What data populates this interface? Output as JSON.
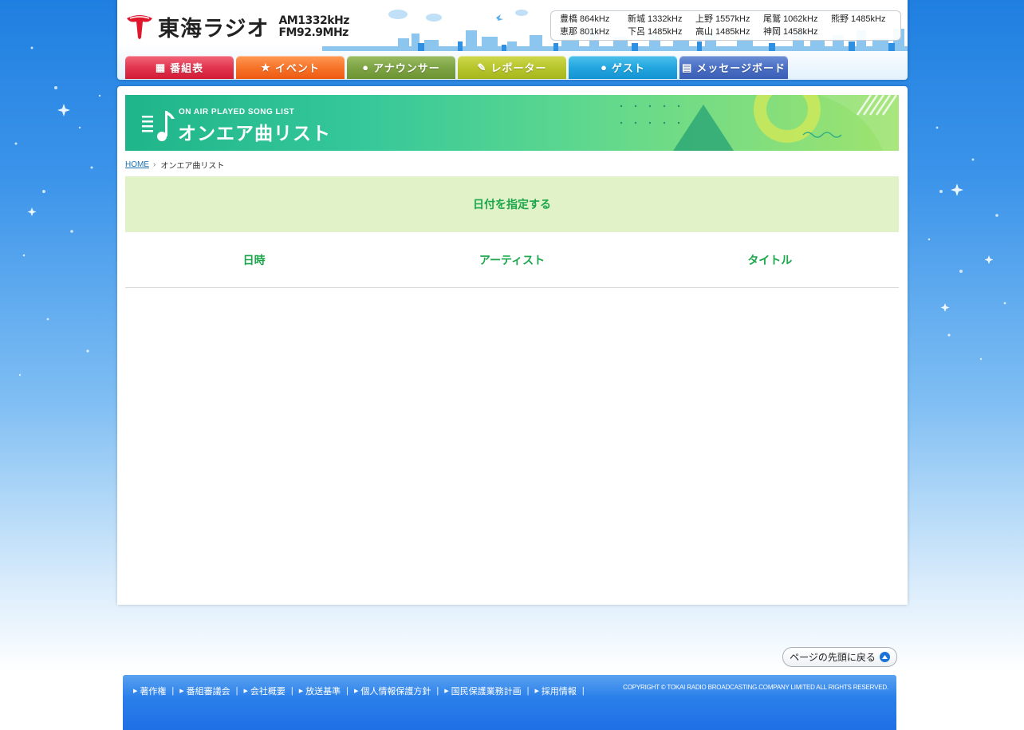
{
  "header": {
    "logo_text": "東海ラジオ",
    "logo_am": "AM1332kHz",
    "logo_fm": "FM92.9MHz",
    "frequencies": [
      "豊橋 864kHz",
      "新城 1332kHz",
      "上野 1557kHz",
      "尾鷲 1062kHz",
      "熊野 1485kHz",
      "恵那 801kHz",
      "下呂 1485kHz",
      "高山 1485kHz",
      "神岡 1458kHz"
    ]
  },
  "nav": {
    "tabs": [
      {
        "label": "番組表",
        "icon": "grid-icon",
        "color": "#e2364f"
      },
      {
        "label": "イベント",
        "icon": "star-icon",
        "color": "#f7742a"
      },
      {
        "label": "アナウンサー",
        "icon": "person-icon",
        "color": "#7ea445"
      },
      {
        "label": "レポーター",
        "icon": "microphone-icon",
        "color": "#b8c62d"
      },
      {
        "label": "ゲスト",
        "icon": "person-icon",
        "color": "#23a6df"
      },
      {
        "label": "メッセージボード",
        "icon": "board-icon",
        "color": "#4a70c5"
      }
    ]
  },
  "banner": {
    "subtitle": "ON AIR PLAYED SONG LIST",
    "title": "オンエア曲リスト"
  },
  "breadcrumb": {
    "home": "HOME",
    "current": "オンエア曲リスト"
  },
  "date_picker": {
    "label": "日付を指定する"
  },
  "table": {
    "headers": [
      "日時",
      "アーティスト",
      "タイトル"
    ]
  },
  "pagetop": {
    "label": "ページの先頭に戻る"
  },
  "footer": {
    "links": [
      "著作権",
      "番組審議会",
      "会社概要",
      "放送基準",
      "個人情報保護方針",
      "国民保護業務計画",
      "採用情報"
    ],
    "copyright": "COPYRIGHT © TOKAI RADIO BROADCASTING.COMPANY LIMITED ALL RIGHTS RESERVED."
  },
  "colors": {
    "accent_green": "#1aa64a",
    "date_bar_bg": "#e1f2c8",
    "footer_blue": "#2b80ea"
  }
}
